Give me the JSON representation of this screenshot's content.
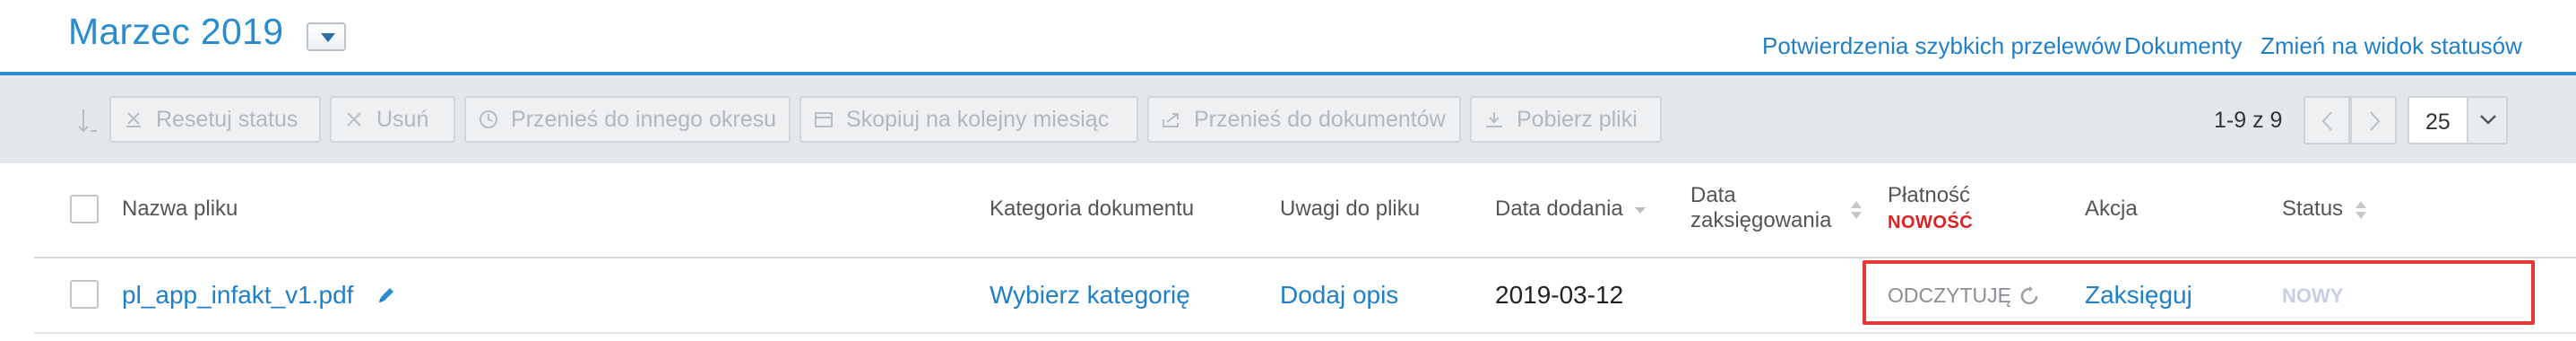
{
  "header": {
    "title": "Marzec 2019",
    "links": {
      "quick_transfers": "Potwierdzenia szybkich przelewów",
      "documents": "Dokumenty",
      "status_view": "Zmień na widok statusów"
    }
  },
  "toolbar": {
    "reset_status": "Resetuj status",
    "delete": "Usuń",
    "move_period": "Przenieś do innego okresu",
    "copy_next_month": "Skopiuj na kolejny miesiąc",
    "move_documents": "Przenieś do dokumentów",
    "download_files": "Pobierz pliki"
  },
  "pagination": {
    "range": "1-9 z 9",
    "per_page": "25"
  },
  "table": {
    "columns": {
      "file_name": "Nazwa pliku",
      "category": "Kategoria dokumentu",
      "notes": "Uwagi do pliku",
      "date_added": "Data dodania",
      "date_booked": "Data zaksięgowania",
      "payment": "Płatność",
      "payment_badge": "NOWOŚĆ",
      "action": "Akcja",
      "status": "Status"
    },
    "rows": [
      {
        "file_name": "pl_app_infakt_v1.pdf",
        "category": "Wybierz kategorię",
        "notes": "Dodaj opis",
        "date_added": "2019-03-12",
        "payment": "ODCZYTUJĘ",
        "action": "Zaksięguj",
        "status": "NOWY"
      }
    ]
  },
  "colors": {
    "accent": "#2a8cd0",
    "link": "#1f7fc7",
    "toolbar_bg": "#e5e8eb",
    "badge_red": "#e02020",
    "highlight": "#e53935"
  }
}
